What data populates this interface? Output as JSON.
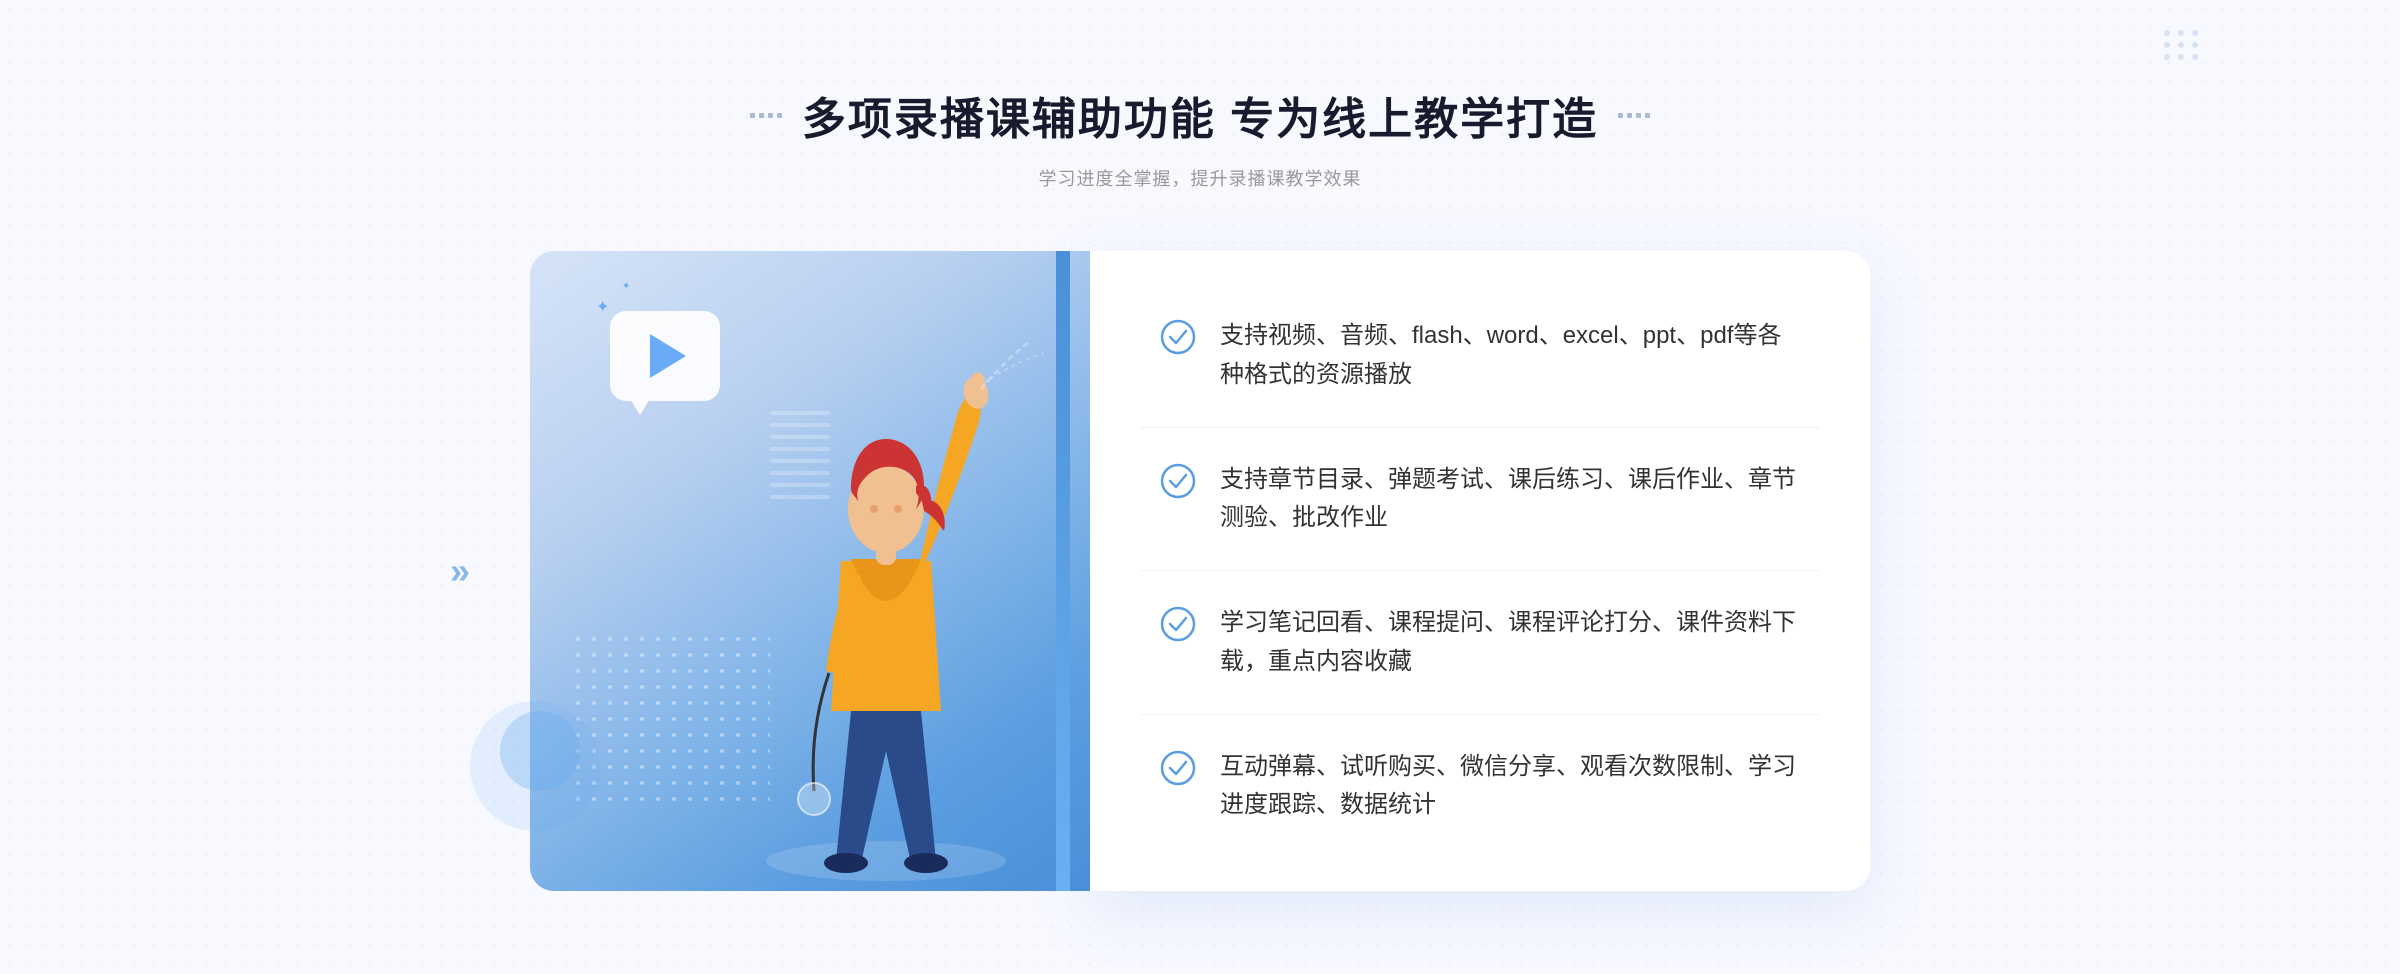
{
  "header": {
    "title": "多项录播课辅助功能 专为线上教学打造",
    "subtitle": "学习进度全掌握，提升录播课教学效果"
  },
  "features": [
    {
      "id": 1,
      "text": "支持视频、音频、flash、word、excel、ppt、pdf等各种格式的资源播放"
    },
    {
      "id": 2,
      "text": "支持章节目录、弹题考试、课后练习、课后作业、章节测验、批改作业"
    },
    {
      "id": 3,
      "text": "学习笔记回看、课程提问、课程评论打分、课件资料下载，重点内容收藏"
    },
    {
      "id": 4,
      "text": "互动弹幕、试听购买、微信分享、观看次数限制、学习进度跟踪、数据统计"
    }
  ],
  "decorations": {
    "check_color": "#5a9de0",
    "accent_color": "#4a8fd8",
    "title_color": "#1a1a2e",
    "subtitle_color": "#999999"
  }
}
